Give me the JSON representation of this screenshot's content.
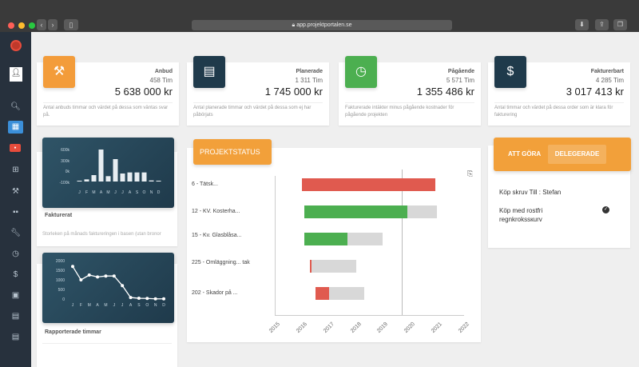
{
  "browser": {
    "url": "app.projektportalen.se",
    "back": "‹",
    "forward": "›"
  },
  "sidebar": {
    "icons": [
      "logo-icon",
      "avatar-icon",
      "search-icon",
      "dashboard-icon",
      "badge-icon",
      "plus-icon",
      "gavel-icon",
      "grid-icon",
      "wrench-icon",
      "clock-icon",
      "dollar-icon",
      "image-icon",
      "calendar-icon",
      "calendar-icon-2"
    ]
  },
  "stats": [
    {
      "title": "Anbud",
      "sub": "458 Tim",
      "value": "5 638 000 kr",
      "desc": "Antal anbuds timmar och värdet på dessa som väntas svar på.",
      "color": "#f39c3a",
      "icon": "gavel-icon"
    },
    {
      "title": "Planerade",
      "sub": "1 311 Tim",
      "value": "1 745 000 kr",
      "desc": "Antal planerade timmar och värdet på dessa som ej har påbörjats",
      "color": "#1f3a4b",
      "icon": "calendar-icon"
    },
    {
      "title": "Pågående",
      "sub": "5 571 Tim",
      "value": "1 355 486 kr",
      "desc": "Fakturerade intäkter minus pågående kostnader för pågående projekten",
      "color": "#4caf50",
      "icon": "clock-icon"
    },
    {
      "title": "Fakturerbart",
      "sub": "4 285 Tim",
      "value": "3 017 413 kr",
      "desc": "Antal timmar och värdet på dessa order som är klara för fakturering",
      "color": "#1f3a4b",
      "icon": "dollar-icon"
    }
  ],
  "fakturerat": {
    "title": "Fakturerat",
    "desc": "Storleken på månads faktureringen i basen (utan bronor",
    "ylabels": [
      "600k",
      "300k",
      "0k",
      "-100k"
    ],
    "months": [
      "J",
      "F",
      "M",
      "A",
      "M",
      "J",
      "J",
      "A",
      "S",
      "O",
      "N",
      "D"
    ],
    "values": [
      0,
      40,
      120,
      600,
      100,
      420,
      150,
      170,
      170,
      170,
      20,
      0
    ]
  },
  "rapporterade": {
    "title": "Rapporterade timmar",
    "ylabels": [
      "2000",
      "1500",
      "1000",
      "500",
      "0"
    ],
    "months": [
      "J",
      "F",
      "M",
      "A",
      "M",
      "J",
      "J",
      "A",
      "S",
      "O",
      "N",
      "D"
    ],
    "values": [
      1700,
      1000,
      1250,
      1150,
      1200,
      1200,
      700,
      80,
      40,
      30,
      10,
      10
    ]
  },
  "projektstatus": {
    "title": "PROJEKTSTATUS",
    "rows": [
      {
        "label": "6 - Tätsk...",
        "start": 2016.0,
        "end": 2020.95,
        "color": "#e05a4f",
        "grey_end": null
      },
      {
        "label": "12 - KV. Kosterha...",
        "start": 2016.1,
        "end": 2019.9,
        "color": "#4caf50",
        "grey_end": 2021.0
      },
      {
        "label": "15 - Kv. Glasblåsa...",
        "start": 2016.1,
        "end": 2017.7,
        "color": "#4caf50",
        "grey_end": 2019.0
      },
      {
        "label": "225 - Omläggning... tak",
        "start": 2016.3,
        "end": 2016.35,
        "color": "#e05a4f",
        "grey_end": 2018.0
      },
      {
        "label": "202 - Skador på ...",
        "start": 2016.5,
        "end": 2017.0,
        "color": "#e05a4f",
        "grey_end": 2018.3
      }
    ],
    "years": [
      "2015",
      "2016",
      "2017",
      "2018",
      "2019",
      "2020",
      "2021",
      "2022"
    ],
    "today": 2019.7
  },
  "todo": {
    "tab_active": "ATT GÖRA",
    "tab_other": "DELEGERADE",
    "items": [
      {
        "text": "Köp skruv Till : Stefan",
        "done": false
      },
      {
        "text": "Köp med rostfri regnkrokssкurv",
        "done": true
      }
    ]
  }
}
